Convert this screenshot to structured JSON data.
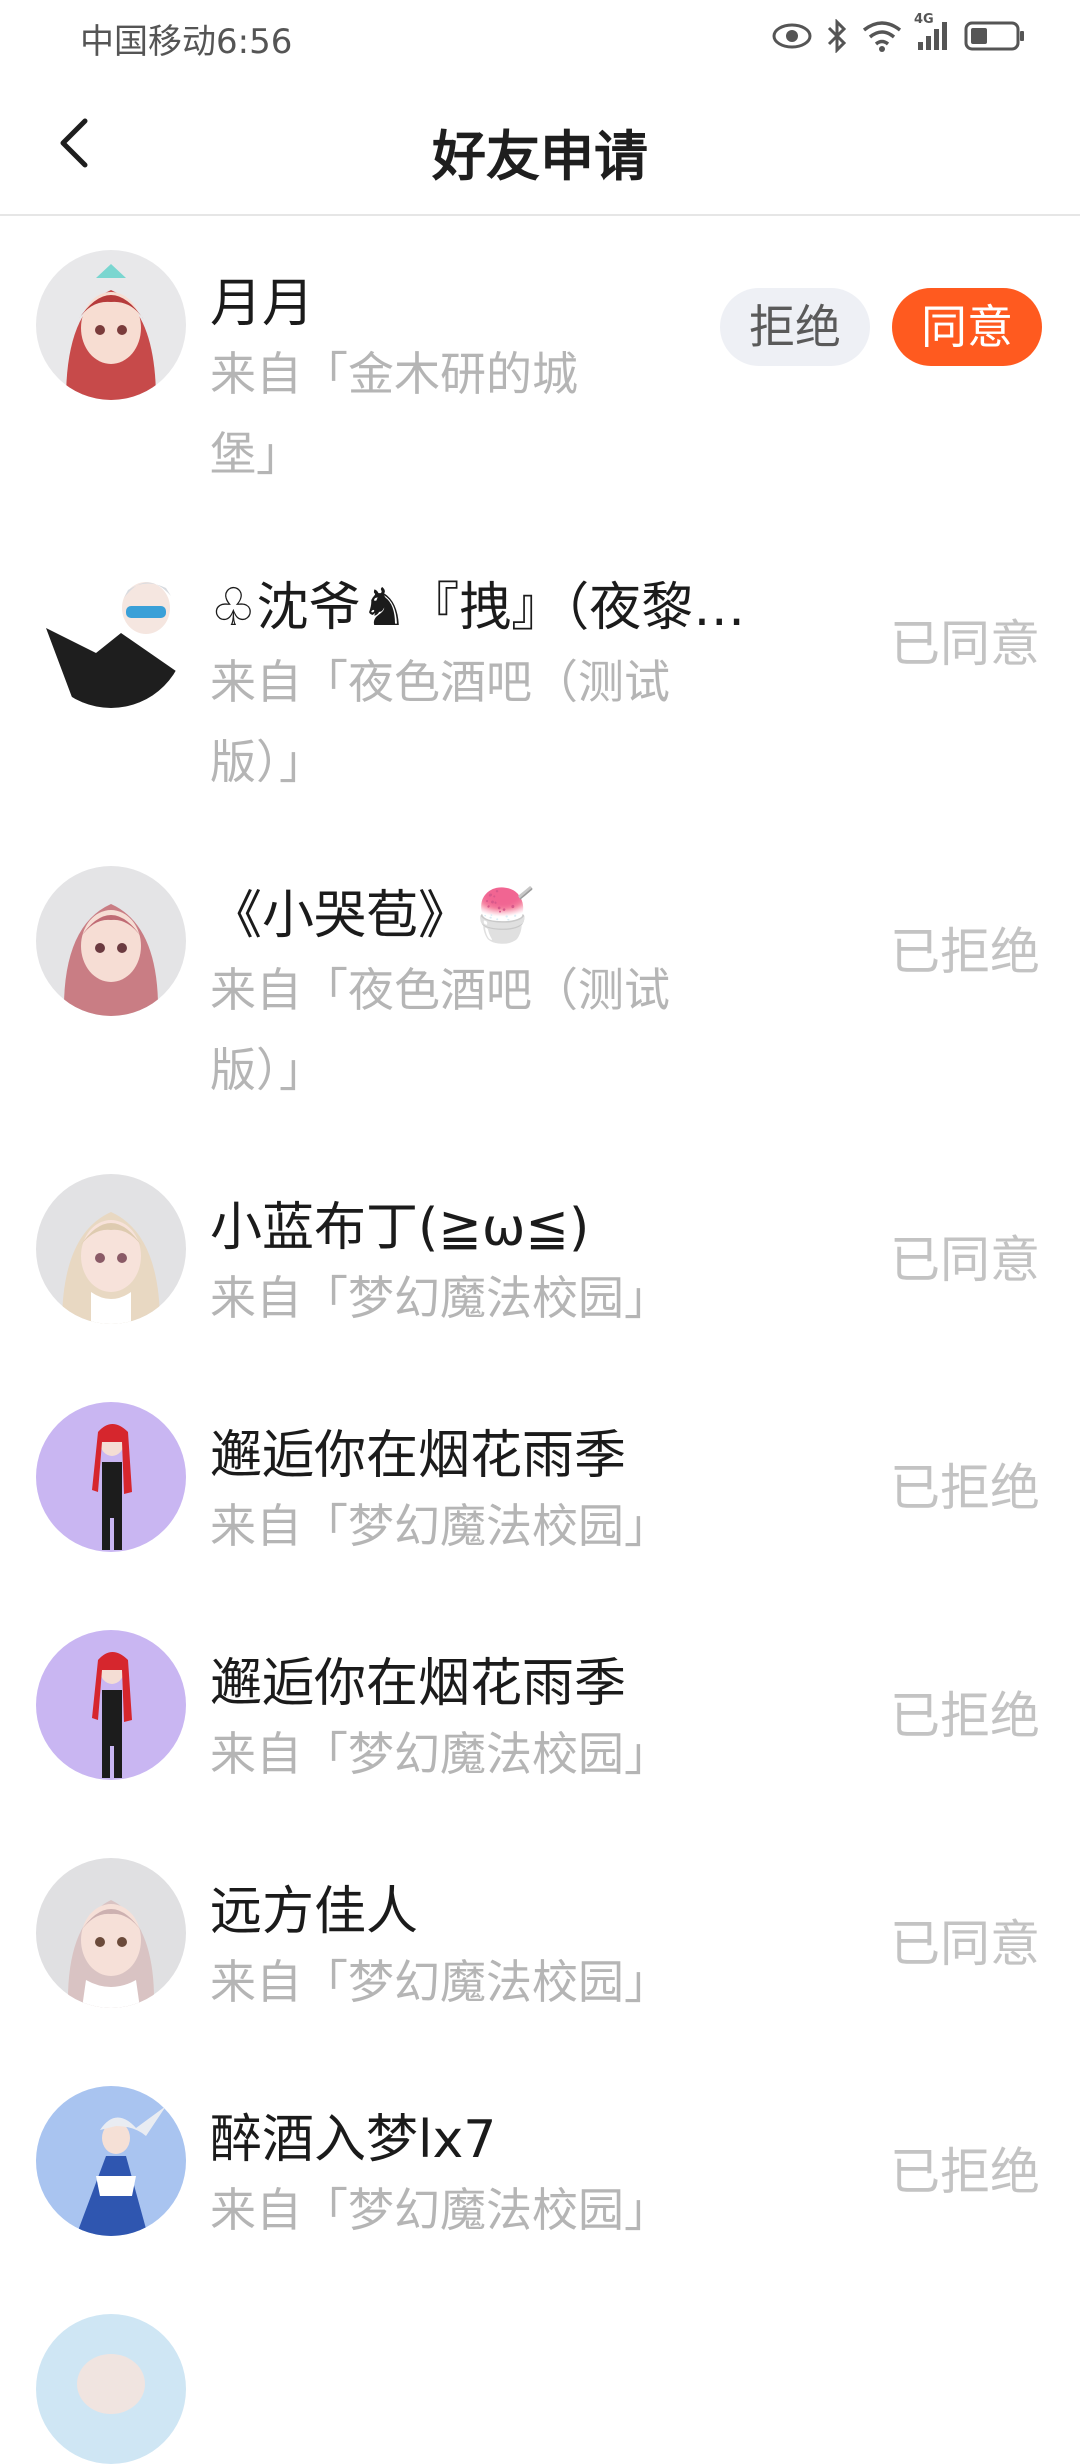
{
  "status_bar": {
    "carrier": "中国移动",
    "time": "6:56",
    "network": "4G"
  },
  "header": {
    "back_icon": "chevron-left-icon",
    "title": "好友申请"
  },
  "actions": {
    "reject": "拒绝",
    "agree": "同意"
  },
  "requests": [
    {
      "name": "月月",
      "source_line1": "来自「金木研的城",
      "source_line2": "堡」",
      "status": ""
    },
    {
      "name": "♧沈爷♞『拽』（夜黎…",
      "source_line1": "来自「夜色酒吧（测试",
      "source_line2": "版）」",
      "status": "已同意"
    },
    {
      "name": "《小哭苞》🍧",
      "source_line1": "来自「夜色酒吧（测试",
      "source_line2": "版）」",
      "status": "已拒绝"
    },
    {
      "name": "小蓝布丁(≧ω≦)",
      "source_line1": "来自「梦幻魔法校园」",
      "source_line2": "",
      "status": "已同意"
    },
    {
      "name": "邂逅你在烟花雨季",
      "source_line1": "来自「梦幻魔法校园」",
      "source_line2": "",
      "status": "已拒绝"
    },
    {
      "name": "邂逅你在烟花雨季",
      "source_line1": "来自「梦幻魔法校园」",
      "source_line2": "",
      "status": "已拒绝"
    },
    {
      "name": "远方佳人",
      "source_line1": "来自「梦幻魔法校园」",
      "source_line2": "",
      "status": "已同意"
    },
    {
      "name": "醉酒入梦lx7",
      "source_line1": "来自「梦幻魔法校园」",
      "source_line2": "",
      "status": "已拒绝"
    }
  ]
}
